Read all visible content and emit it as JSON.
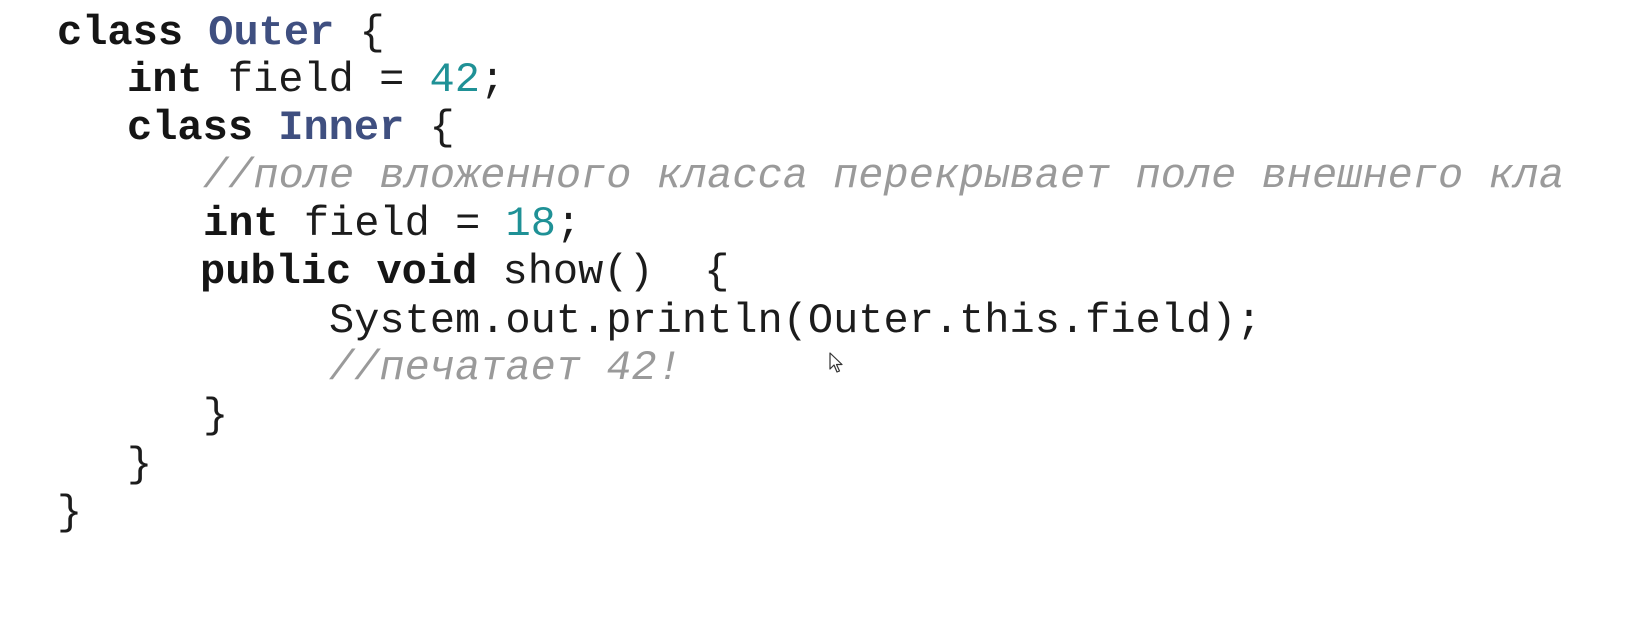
{
  "code": {
    "line1": {
      "kw": "class",
      "name": "Outer",
      "brace": "{"
    },
    "line2": {
      "type": "int",
      "rest": "field = ",
      "value": "42",
      "end": ";"
    },
    "line3": {
      "kw": "class",
      "name": "Inner",
      "brace": "{"
    },
    "line4": {
      "comment": "//поле вложенного класса перекрывает поле внешнего кла"
    },
    "line5": {
      "type": "int",
      "rest": "field = ",
      "value": "18",
      "end": ";"
    },
    "line6": {
      "kw1": "public",
      "kw2": "void",
      "rest": "show()  {"
    },
    "line7": {
      "text": "System.out.println(Outer.this.field);"
    },
    "line8": {
      "comment": "//печатает 42!"
    },
    "line9": {
      "brace": "}"
    },
    "line10": {
      "brace": "}"
    },
    "line11": {
      "brace": "}"
    }
  },
  "colors": {
    "keyword": "#151515",
    "class_name": "#3f4f80",
    "number": "#1f9196",
    "comment": "#9a9a9a",
    "background": "#ffffff"
  },
  "icons": {
    "cursor": "mouse-pointer-icon"
  }
}
